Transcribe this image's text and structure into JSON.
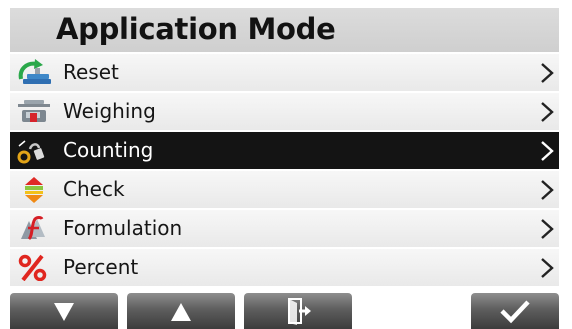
{
  "header": {
    "title": "Application Mode"
  },
  "menu": {
    "items": [
      {
        "label": "Reset",
        "icon": "reset-icon",
        "selected": false
      },
      {
        "label": "Weighing",
        "icon": "weighing-scale-icon",
        "selected": false
      },
      {
        "label": "Counting",
        "icon": "counting-weights-icon",
        "selected": true
      },
      {
        "label": "Check",
        "icon": "check-arrows-icon",
        "selected": false
      },
      {
        "label": "Formulation",
        "icon": "formulation-icon",
        "selected": false
      },
      {
        "label": "Percent",
        "icon": "percent-icon",
        "selected": false
      }
    ]
  },
  "softkeys": [
    {
      "name": "down-arrow-icon"
    },
    {
      "name": "up-arrow-icon"
    },
    {
      "name": "exit-icon"
    },
    {
      "name": "checkmark-icon"
    }
  ],
  "colors": {
    "header_bg": "#d4d4d4",
    "row_bg": "#efefef",
    "selected_bg": "#141414",
    "softkey_bg": "#5e5e5e",
    "percent_red": "#e0261f"
  }
}
